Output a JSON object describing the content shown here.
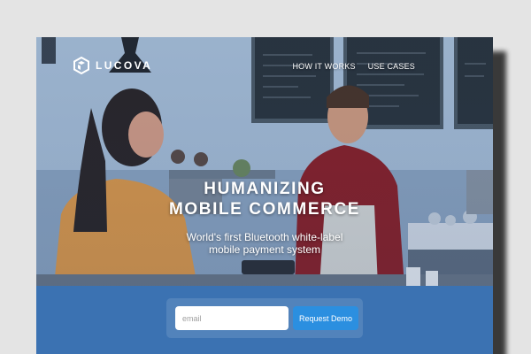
{
  "brand": {
    "name": "LUCOVA",
    "logo_icon": "hexagon-logo-icon"
  },
  "nav": {
    "links": [
      {
        "label": "HOW IT WORKS"
      },
      {
        "label": "USE CASES"
      }
    ]
  },
  "hero": {
    "headline_line1": "HUMANIZING",
    "headline_line2": "MOBILE COMMERCE",
    "subline_line1": "World's first Bluetooth white-label",
    "subline_line2": "mobile payment system"
  },
  "signup": {
    "email_placeholder": "email",
    "button_label": "Request Demo"
  },
  "colors": {
    "band": "#3b72b2",
    "button": "#2b8fe0",
    "text": "#ffffff"
  }
}
